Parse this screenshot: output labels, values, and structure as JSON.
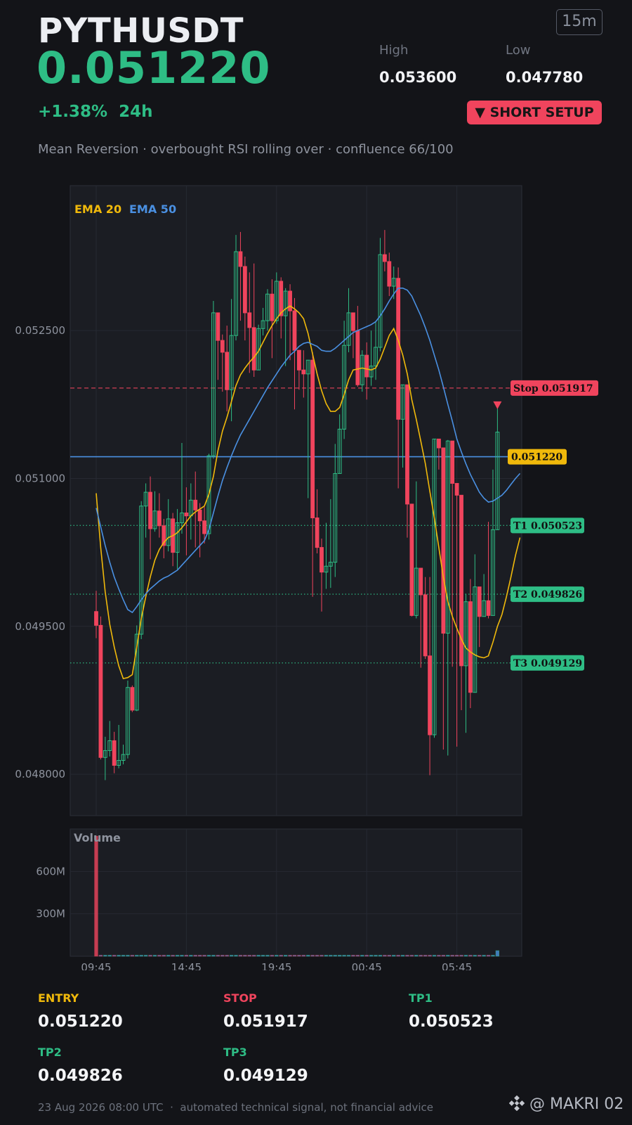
{
  "header": {
    "symbol": "PYTHUSDT",
    "price": "0.051220",
    "timeframe": "15m",
    "high_label": "High",
    "high_value": "0.053600",
    "low_label": "Low",
    "low_value": "0.047780",
    "change": "+1.38%  24h",
    "signal_badge": "▼ SHORT SETUP",
    "subtitle": "Mean Reversion · overbought RSI rolling over · confluence 66/100"
  },
  "levels": {
    "entry_label": "ENTRY",
    "entry_value": "0.051220",
    "stop_label": "STOP",
    "stop_value": "0.051917",
    "tp1_label": "TP1",
    "tp1_value": "0.050523",
    "tp2_label": "TP2",
    "tp2_value": "0.049826",
    "tp3_label": "TP3",
    "tp3_value": "0.049129"
  },
  "footer": {
    "timestamp_note": "23 Aug 2026 08:00 UTC  ·  automated technical signal, not financial advice",
    "brand": "@ MAKRI 02"
  },
  "colors": {
    "bg": "#131418",
    "panel": "#1b1d23",
    "grid": "#262932",
    "bull": "#2ebd85",
    "bear": "#f0445d",
    "ema20": "#f0b90b",
    "ema50": "#4a90e2",
    "muted": "#8e939e"
  },
  "icons": {
    "brand": "binance-diamond-icon",
    "signal_arrow": "triangle-down-icon"
  },
  "chart_data": [
    {
      "type": "candlestick",
      "legend": [
        "EMA 20",
        "EMA 50"
      ],
      "y_ticks": [
        "0.052500",
        "0.051000",
        "0.049500",
        "0.048000"
      ],
      "y_tick_values": [
        0.0525,
        0.051,
        0.0495,
        0.048
      ],
      "ylim": [
        0.04758,
        0.05397
      ],
      "x_ticks": [
        "09:45",
        "14:45",
        "19:45",
        "00:45",
        "05:45"
      ],
      "x_tick_index": [
        0,
        20,
        40,
        60,
        80
      ],
      "grid": true,
      "last_price_label": "0.051220",
      "last_price_value": 0.05122,
      "lines": [
        {
          "name": "Stop",
          "label": "Stop 0.051917",
          "value": 0.051917,
          "style": "dashed",
          "color": "#f0445d"
        },
        {
          "name": "T1",
          "label": "T1 0.050523",
          "value": 0.050523,
          "style": "dotted",
          "color": "#2ebd85"
        },
        {
          "name": "T2",
          "label": "T2 0.049826",
          "value": 0.049826,
          "style": "dotted",
          "color": "#2ebd85"
        },
        {
          "name": "T3",
          "label": "T3 0.049129",
          "value": 0.049129,
          "style": "dotted",
          "color": "#2ebd85"
        }
      ],
      "signal_marker_index": 89,
      "candles": [
        [
          0.04965,
          0.04951,
          0.04986,
          0.04938
        ],
        [
          0.04951,
          0.04817,
          0.0496,
          0.04815
        ],
        [
          0.04817,
          0.04824,
          0.04838,
          0.04794
        ],
        [
          0.04824,
          0.04834,
          0.04854,
          0.04818
        ],
        [
          0.04834,
          0.04809,
          0.04843,
          0.04801
        ],
        [
          0.04809,
          0.04814,
          0.0485,
          0.04806
        ],
        [
          0.04814,
          0.0482,
          0.0483,
          0.0481
        ],
        [
          0.0482,
          0.04888,
          0.04895,
          0.04816
        ],
        [
          0.04888,
          0.04865,
          0.0489,
          0.04863
        ],
        [
          0.04865,
          0.04942,
          0.04951,
          0.04864
        ],
        [
          0.04942,
          0.05072,
          0.05077,
          0.04937
        ],
        [
          0.05072,
          0.05086,
          0.05095,
          0.0504
        ],
        [
          0.05086,
          0.05049,
          0.05102,
          0.05018
        ],
        [
          0.05049,
          0.05067,
          0.05087,
          0.05046
        ],
        [
          0.05067,
          0.05052,
          0.05085,
          0.0504
        ],
        [
          0.05052,
          0.05032,
          0.05059,
          0.05019
        ],
        [
          0.05032,
          0.05059,
          0.05079,
          0.05026
        ],
        [
          0.05059,
          0.05025,
          0.05065,
          0.05011
        ],
        [
          0.05025,
          0.05055,
          0.05069,
          0.05008
        ],
        [
          0.05055,
          0.05065,
          0.05136,
          0.05044
        ],
        [
          0.05065,
          0.05062,
          0.05091,
          0.05022
        ],
        [
          0.05062,
          0.05078,
          0.05095,
          0.05038
        ],
        [
          0.05078,
          0.05068,
          0.05107,
          0.0503
        ],
        [
          0.05068,
          0.05057,
          0.05075,
          0.0502
        ],
        [
          0.05057,
          0.05044,
          0.05071,
          0.05034
        ],
        [
          0.05044,
          0.05123,
          0.05125,
          0.05038
        ],
        [
          0.05123,
          0.05268,
          0.0528,
          0.0512
        ],
        [
          0.05268,
          0.0524,
          0.05255,
          0.052
        ],
        [
          0.0524,
          0.05228,
          0.05246,
          0.05188
        ],
        [
          0.05228,
          0.0519,
          0.05255,
          0.05168
        ],
        [
          0.0519,
          0.05245,
          0.05282,
          0.05158
        ],
        [
          0.05245,
          0.0533,
          0.05347,
          0.0524
        ],
        [
          0.0533,
          0.05315,
          0.0535,
          0.0526
        ],
        [
          0.05315,
          0.05268,
          0.05325,
          0.0524
        ],
        [
          0.05268,
          0.05253,
          0.05309,
          0.05207
        ],
        [
          0.05253,
          0.0521,
          0.05318,
          0.05203
        ],
        [
          0.0521,
          0.05252,
          0.05256,
          0.05241
        ],
        [
          0.05252,
          0.0526,
          0.05273,
          0.05245
        ],
        [
          0.0526,
          0.05287,
          0.05292,
          0.0525
        ],
        [
          0.05287,
          0.0526,
          0.05302,
          0.05222
        ],
        [
          0.0526,
          0.053,
          0.05309,
          0.05257
        ],
        [
          0.053,
          0.05265,
          0.05304,
          0.05242
        ],
        [
          0.05265,
          0.0529,
          0.05293,
          0.05214
        ],
        [
          0.0529,
          0.0527,
          0.05297,
          0.0522
        ],
        [
          0.0527,
          0.0523,
          0.05283,
          0.0517
        ],
        [
          0.0523,
          0.0521,
          0.05227,
          0.0519
        ],
        [
          0.0521,
          0.05206,
          0.0523,
          0.05182
        ],
        [
          0.05206,
          0.0522,
          0.05217,
          0.0508
        ],
        [
          0.0522,
          0.0506,
          0.05228,
          0.0498
        ],
        [
          0.0506,
          0.0503,
          0.05089,
          0.05024
        ],
        [
          0.0503,
          0.05005,
          0.05039,
          0.04965
        ],
        [
          0.05005,
          0.05011,
          0.05055,
          0.04988
        ],
        [
          0.05011,
          0.05015,
          0.05079,
          0.04989
        ],
        [
          0.05015,
          0.05105,
          0.05135,
          0.05
        ],
        [
          0.05105,
          0.0515,
          0.05165,
          0.05139
        ],
        [
          0.0515,
          0.05235,
          0.0526,
          0.0514
        ],
        [
          0.05235,
          0.05268,
          0.05293,
          0.05228
        ],
        [
          0.05268,
          0.0525,
          0.0526,
          0.05222
        ],
        [
          0.0525,
          0.05195,
          0.05275,
          0.05193
        ],
        [
          0.05195,
          0.05225,
          0.0523,
          0.05188
        ],
        [
          0.05225,
          0.05203,
          0.05238,
          0.0518
        ],
        [
          0.05203,
          0.05214,
          0.0525,
          0.05194
        ],
        [
          0.05214,
          0.05233,
          0.05259,
          0.052
        ],
        [
          0.05233,
          0.05327,
          0.05344,
          0.05229
        ],
        [
          0.05327,
          0.0532,
          0.05352,
          0.0531
        ],
        [
          0.0532,
          0.05295,
          0.05329,
          0.05285
        ],
        [
          0.05295,
          0.05303,
          0.05315,
          0.05282
        ],
        [
          0.05303,
          0.0516,
          0.05314,
          0.0509
        ],
        [
          0.0516,
          0.05195,
          0.05172,
          0.05111
        ],
        [
          0.05195,
          0.05074,
          0.0516,
          0.0504
        ],
        [
          0.05074,
          0.04961,
          0.05073,
          0.0496
        ],
        [
          0.04961,
          0.05009,
          0.05097,
          0.04958
        ],
        [
          0.05009,
          0.04982,
          0.04987,
          0.04908
        ],
        [
          0.04982,
          0.0492,
          0.05,
          0.04917
        ],
        [
          0.0492,
          0.0484,
          0.05,
          0.04799
        ],
        [
          0.0484,
          0.0514,
          0.05135,
          0.04837
        ],
        [
          0.0514,
          0.05131,
          0.05138,
          0.05109
        ],
        [
          0.05131,
          0.04943,
          0.04943,
          0.04825
        ],
        [
          0.04943,
          0.05138,
          0.05139,
          0.04819
        ],
        [
          0.05138,
          0.05095,
          0.05114,
          0.04909
        ],
        [
          0.05095,
          0.05083,
          0.05095,
          0.04828
        ],
        [
          0.05083,
          0.0491,
          0.05013,
          0.04865
        ],
        [
          0.0491,
          0.04975,
          0.04983,
          0.04842
        ],
        [
          0.04975,
          0.04883,
          0.04998,
          0.04867
        ],
        [
          0.04883,
          0.0499,
          0.05023,
          0.04906
        ],
        [
          0.0499,
          0.0496,
          0.0495,
          0.04929
        ],
        [
          0.0496,
          0.04976,
          0.05003,
          0.04967
        ],
        [
          0.04976,
          0.04961,
          0.05056,
          0.04958
        ],
        [
          0.04961,
          0.05048,
          0.05109,
          0.05032
        ],
        [
          0.05048,
          0.05147,
          0.05175,
          0.0506
        ]
      ],
      "ema20": [
        0.05085,
        0.0503,
        0.04985,
        0.04952,
        0.04929,
        0.0491,
        0.04897,
        0.04898,
        0.04901,
        0.04929,
        0.04958,
        0.0498,
        0.05,
        0.05017,
        0.05028,
        0.05035,
        0.0504,
        0.05042,
        0.05045,
        0.0505,
        0.05056,
        0.05062,
        0.05066,
        0.05069,
        0.05072,
        0.05084,
        0.05102,
        0.05128,
        0.05148,
        0.05162,
        0.05178,
        0.05194,
        0.05205,
        0.05212,
        0.05218,
        0.05223,
        0.05229,
        0.05238,
        0.05247,
        0.05255,
        0.05262,
        0.05268,
        0.05272,
        0.05275,
        0.05272,
        0.05268,
        0.05262,
        0.05247,
        0.05226,
        0.05206,
        0.05189,
        0.05176,
        0.05168,
        0.05168,
        0.05172,
        0.05185,
        0.052,
        0.0521,
        0.05211,
        0.05212,
        0.05211,
        0.0521,
        0.05212,
        0.05221,
        0.05233,
        0.05245,
        0.05252,
        0.0524,
        0.05225,
        0.05206,
        0.0518,
        0.0516,
        0.05138,
        0.05115,
        0.05087,
        0.0506,
        0.0503,
        0.05,
        0.04975,
        0.0496,
        0.04948,
        0.04937,
        0.04928,
        0.04924,
        0.04921,
        0.04919,
        0.04918,
        0.0492,
        0.04934,
        0.0495,
        0.04962,
        0.0498,
        0.05,
        0.05022,
        0.0504
      ],
      "ema50": [
        0.0507,
        0.05051,
        0.05032,
        0.05015,
        0.05,
        0.04988,
        0.04977,
        0.04967,
        0.04964,
        0.0497,
        0.04977,
        0.04983,
        0.04988,
        0.04992,
        0.04996,
        0.04999,
        0.05001,
        0.05004,
        0.05007,
        0.05012,
        0.05017,
        0.05022,
        0.05027,
        0.05032,
        0.05037,
        0.05048,
        0.05065,
        0.05082,
        0.05098,
        0.05111,
        0.05123,
        0.05134,
        0.05144,
        0.05152,
        0.0516,
        0.05168,
        0.05176,
        0.05184,
        0.05192,
        0.05199,
        0.05206,
        0.05213,
        0.05219,
        0.05225,
        0.05229,
        0.05234,
        0.05237,
        0.05238,
        0.05236,
        0.05234,
        0.0523,
        0.05229,
        0.05229,
        0.05232,
        0.05236,
        0.0524,
        0.05244,
        0.05248,
        0.0525,
        0.05252,
        0.05254,
        0.05256,
        0.05259,
        0.05265,
        0.05272,
        0.0528,
        0.05287,
        0.05293,
        0.05293,
        0.05291,
        0.05285,
        0.05275,
        0.05265,
        0.05253,
        0.0524,
        0.05225,
        0.0521,
        0.05193,
        0.05175,
        0.05158,
        0.0514,
        0.05127,
        0.05115,
        0.05104,
        0.05095,
        0.05086,
        0.0508,
        0.05076,
        0.05077,
        0.0508,
        0.05083,
        0.05088,
        0.05094,
        0.051,
        0.05105
      ]
    },
    {
      "type": "bar",
      "title": "Volume",
      "y_ticks": [
        "600M",
        "300M"
      ],
      "y_tick_values": [
        600,
        300
      ],
      "ylim": [
        0,
        900
      ],
      "values": [
        850,
        4,
        6,
        0,
        0,
        0,
        0,
        0,
        0,
        0,
        0,
        0,
        0,
        0,
        0,
        0,
        0,
        0,
        0,
        0,
        0,
        0,
        0,
        0,
        0,
        0,
        0,
        0,
        0,
        0,
        0,
        0,
        0,
        0,
        0,
        0,
        0,
        0,
        0,
        0,
        0,
        0,
        0,
        0,
        0,
        0,
        0,
        0,
        0,
        0,
        0,
        0,
        0,
        0,
        0,
        0,
        0,
        0,
        0,
        0,
        0,
        0,
        0,
        0,
        0,
        0,
        0,
        0,
        0,
        0,
        0,
        0,
        0,
        0,
        0,
        0,
        0,
        0,
        0,
        0,
        0,
        0,
        0,
        0,
        0,
        0,
        0,
        0,
        0,
        40
      ],
      "x_ticks": [
        "09:45",
        "14:45",
        "19:45",
        "00:45",
        "05:45"
      ]
    }
  ]
}
